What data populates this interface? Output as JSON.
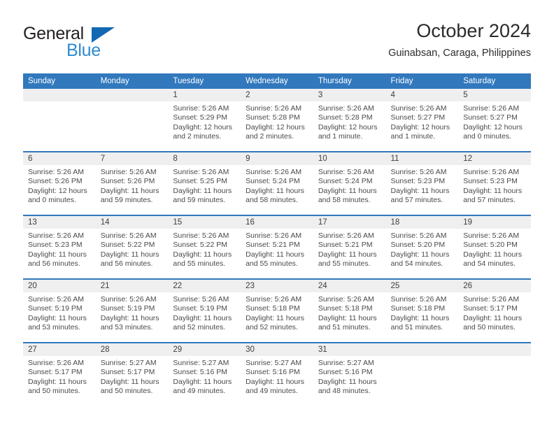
{
  "brand": {
    "name_part1": "General",
    "name_part2": "Blue",
    "triangle_icon": "triangle-icon",
    "color_dark": "#231f20",
    "color_blue": "#2e8bd0"
  },
  "header": {
    "title": "October 2024",
    "subtitle": "Guinabsan, Caraga, Philippines"
  },
  "theme": {
    "header_blue": "#3178bd",
    "date_band_gray": "#efefef"
  },
  "weekdays": [
    "Sunday",
    "Monday",
    "Tuesday",
    "Wednesday",
    "Thursday",
    "Friday",
    "Saturday"
  ],
  "weeks": [
    {
      "days": [
        {
          "date": "",
          "sunrise": "",
          "sunset": "",
          "daylight1": "",
          "daylight2": ""
        },
        {
          "date": "",
          "sunrise": "",
          "sunset": "",
          "daylight1": "",
          "daylight2": ""
        },
        {
          "date": "1",
          "sunrise": "Sunrise: 5:26 AM",
          "sunset": "Sunset: 5:29 PM",
          "daylight1": "Daylight: 12 hours",
          "daylight2": "and 2 minutes."
        },
        {
          "date": "2",
          "sunrise": "Sunrise: 5:26 AM",
          "sunset": "Sunset: 5:28 PM",
          "daylight1": "Daylight: 12 hours",
          "daylight2": "and 2 minutes."
        },
        {
          "date": "3",
          "sunrise": "Sunrise: 5:26 AM",
          "sunset": "Sunset: 5:28 PM",
          "daylight1": "Daylight: 12 hours",
          "daylight2": "and 1 minute."
        },
        {
          "date": "4",
          "sunrise": "Sunrise: 5:26 AM",
          "sunset": "Sunset: 5:27 PM",
          "daylight1": "Daylight: 12 hours",
          "daylight2": "and 1 minute."
        },
        {
          "date": "5",
          "sunrise": "Sunrise: 5:26 AM",
          "sunset": "Sunset: 5:27 PM",
          "daylight1": "Daylight: 12 hours",
          "daylight2": "and 0 minutes."
        }
      ]
    },
    {
      "days": [
        {
          "date": "6",
          "sunrise": "Sunrise: 5:26 AM",
          "sunset": "Sunset: 5:26 PM",
          "daylight1": "Daylight: 12 hours",
          "daylight2": "and 0 minutes."
        },
        {
          "date": "7",
          "sunrise": "Sunrise: 5:26 AM",
          "sunset": "Sunset: 5:26 PM",
          "daylight1": "Daylight: 11 hours",
          "daylight2": "and 59 minutes."
        },
        {
          "date": "8",
          "sunrise": "Sunrise: 5:26 AM",
          "sunset": "Sunset: 5:25 PM",
          "daylight1": "Daylight: 11 hours",
          "daylight2": "and 59 minutes."
        },
        {
          "date": "9",
          "sunrise": "Sunrise: 5:26 AM",
          "sunset": "Sunset: 5:24 PM",
          "daylight1": "Daylight: 11 hours",
          "daylight2": "and 58 minutes."
        },
        {
          "date": "10",
          "sunrise": "Sunrise: 5:26 AM",
          "sunset": "Sunset: 5:24 PM",
          "daylight1": "Daylight: 11 hours",
          "daylight2": "and 58 minutes."
        },
        {
          "date": "11",
          "sunrise": "Sunrise: 5:26 AM",
          "sunset": "Sunset: 5:23 PM",
          "daylight1": "Daylight: 11 hours",
          "daylight2": "and 57 minutes."
        },
        {
          "date": "12",
          "sunrise": "Sunrise: 5:26 AM",
          "sunset": "Sunset: 5:23 PM",
          "daylight1": "Daylight: 11 hours",
          "daylight2": "and 57 minutes."
        }
      ]
    },
    {
      "days": [
        {
          "date": "13",
          "sunrise": "Sunrise: 5:26 AM",
          "sunset": "Sunset: 5:23 PM",
          "daylight1": "Daylight: 11 hours",
          "daylight2": "and 56 minutes."
        },
        {
          "date": "14",
          "sunrise": "Sunrise: 5:26 AM",
          "sunset": "Sunset: 5:22 PM",
          "daylight1": "Daylight: 11 hours",
          "daylight2": "and 56 minutes."
        },
        {
          "date": "15",
          "sunrise": "Sunrise: 5:26 AM",
          "sunset": "Sunset: 5:22 PM",
          "daylight1": "Daylight: 11 hours",
          "daylight2": "and 55 minutes."
        },
        {
          "date": "16",
          "sunrise": "Sunrise: 5:26 AM",
          "sunset": "Sunset: 5:21 PM",
          "daylight1": "Daylight: 11 hours",
          "daylight2": "and 55 minutes."
        },
        {
          "date": "17",
          "sunrise": "Sunrise: 5:26 AM",
          "sunset": "Sunset: 5:21 PM",
          "daylight1": "Daylight: 11 hours",
          "daylight2": "and 55 minutes."
        },
        {
          "date": "18",
          "sunrise": "Sunrise: 5:26 AM",
          "sunset": "Sunset: 5:20 PM",
          "daylight1": "Daylight: 11 hours",
          "daylight2": "and 54 minutes."
        },
        {
          "date": "19",
          "sunrise": "Sunrise: 5:26 AM",
          "sunset": "Sunset: 5:20 PM",
          "daylight1": "Daylight: 11 hours",
          "daylight2": "and 54 minutes."
        }
      ]
    },
    {
      "days": [
        {
          "date": "20",
          "sunrise": "Sunrise: 5:26 AM",
          "sunset": "Sunset: 5:19 PM",
          "daylight1": "Daylight: 11 hours",
          "daylight2": "and 53 minutes."
        },
        {
          "date": "21",
          "sunrise": "Sunrise: 5:26 AM",
          "sunset": "Sunset: 5:19 PM",
          "daylight1": "Daylight: 11 hours",
          "daylight2": "and 53 minutes."
        },
        {
          "date": "22",
          "sunrise": "Sunrise: 5:26 AM",
          "sunset": "Sunset: 5:19 PM",
          "daylight1": "Daylight: 11 hours",
          "daylight2": "and 52 minutes."
        },
        {
          "date": "23",
          "sunrise": "Sunrise: 5:26 AM",
          "sunset": "Sunset: 5:18 PM",
          "daylight1": "Daylight: 11 hours",
          "daylight2": "and 52 minutes."
        },
        {
          "date": "24",
          "sunrise": "Sunrise: 5:26 AM",
          "sunset": "Sunset: 5:18 PM",
          "daylight1": "Daylight: 11 hours",
          "daylight2": "and 51 minutes."
        },
        {
          "date": "25",
          "sunrise": "Sunrise: 5:26 AM",
          "sunset": "Sunset: 5:18 PM",
          "daylight1": "Daylight: 11 hours",
          "daylight2": "and 51 minutes."
        },
        {
          "date": "26",
          "sunrise": "Sunrise: 5:26 AM",
          "sunset": "Sunset: 5:17 PM",
          "daylight1": "Daylight: 11 hours",
          "daylight2": "and 50 minutes."
        }
      ]
    },
    {
      "days": [
        {
          "date": "27",
          "sunrise": "Sunrise: 5:26 AM",
          "sunset": "Sunset: 5:17 PM",
          "daylight1": "Daylight: 11 hours",
          "daylight2": "and 50 minutes."
        },
        {
          "date": "28",
          "sunrise": "Sunrise: 5:27 AM",
          "sunset": "Sunset: 5:17 PM",
          "daylight1": "Daylight: 11 hours",
          "daylight2": "and 50 minutes."
        },
        {
          "date": "29",
          "sunrise": "Sunrise: 5:27 AM",
          "sunset": "Sunset: 5:16 PM",
          "daylight1": "Daylight: 11 hours",
          "daylight2": "and 49 minutes."
        },
        {
          "date": "30",
          "sunrise": "Sunrise: 5:27 AM",
          "sunset": "Sunset: 5:16 PM",
          "daylight1": "Daylight: 11 hours",
          "daylight2": "and 49 minutes."
        },
        {
          "date": "31",
          "sunrise": "Sunrise: 5:27 AM",
          "sunset": "Sunset: 5:16 PM",
          "daylight1": "Daylight: 11 hours",
          "daylight2": "and 48 minutes."
        },
        {
          "date": "",
          "sunrise": "",
          "sunset": "",
          "daylight1": "",
          "daylight2": ""
        },
        {
          "date": "",
          "sunrise": "",
          "sunset": "",
          "daylight1": "",
          "daylight2": ""
        }
      ]
    }
  ]
}
